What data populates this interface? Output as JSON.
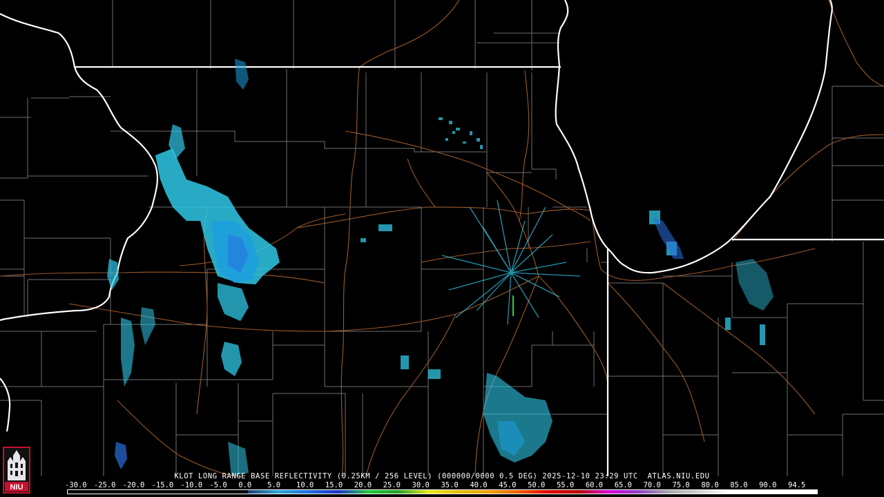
{
  "product": {
    "caption": "KLOT LONG RANGE BASE REFLECTIVITY (0.25KM / 256 LEVEL) (000000/0000 0.5 DEG) 2025-12-10 23:29 UTC  ATLAS.NIU.EDU"
  },
  "colorscale": {
    "labels": [
      "-30.0",
      "-25.0",
      "-20.0",
      "-15.0",
      "-10.0",
      "-5.0",
      "0.0",
      "5.0",
      "10.0",
      "15.0",
      "20.0",
      "25.0",
      "30.0",
      "35.0",
      "40.0",
      "45.0",
      "50.0",
      "55.0",
      "60.0",
      "65.0",
      "70.0",
      "75.0",
      "80.0",
      "85.0",
      "90.0",
      "94.5"
    ],
    "colors": [
      "#000000",
      "#000000",
      "#000000",
      "#000000",
      "#000000",
      "#000000",
      "#1e3c6e",
      "#2aa8d8",
      "#1f6fe0",
      "#1a33c8",
      "#22c83a",
      "#22a028",
      "#e8e818",
      "#e0c000",
      "#f0a000",
      "#f06000",
      "#e00000",
      "#b40000",
      "#d800d8",
      "#9040c8",
      "#a8a8a8",
      "#d0d0d0",
      "#ffffff",
      "#ffffff",
      "#ffffff"
    ]
  },
  "logo": {
    "text": "NIU",
    "icon": "niu-tower-icon"
  },
  "colors": {
    "state_border": "#ffffff",
    "county_line": "#6f6f6f",
    "highway": "#9b5a2c",
    "echo_light": "#2fc8e8",
    "echo_mid": "#1b9ee0",
    "echo_blue": "#2a6fe0",
    "echo_green": "#30d040"
  }
}
